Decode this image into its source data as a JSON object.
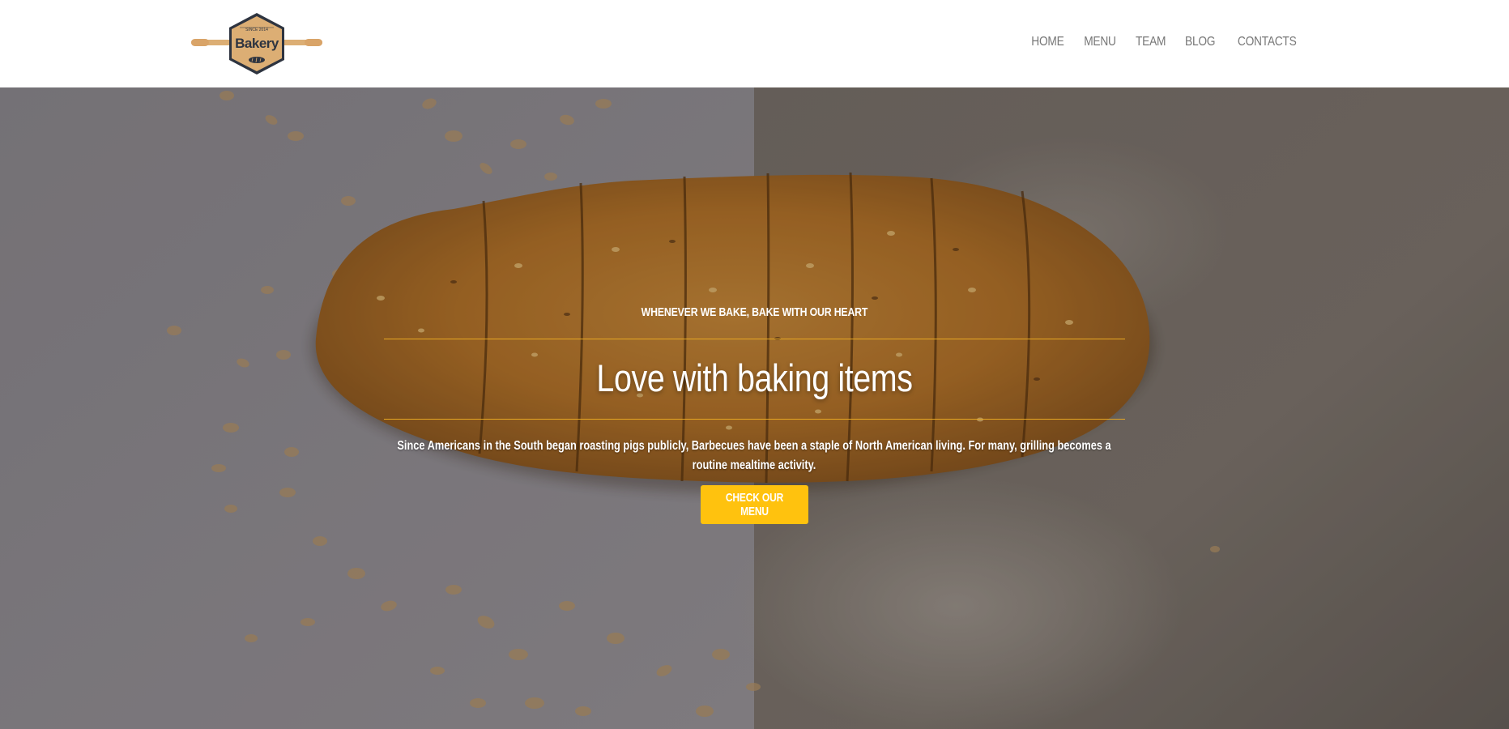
{
  "logo": {
    "text": "Bakery",
    "since": "SINCE 2014"
  },
  "nav": {
    "items": [
      "HOME",
      "MENU",
      "TEAM",
      "BLOG",
      "CONTACTS"
    ]
  },
  "hero": {
    "eyebrow": "WHENEVER WE BAKE, BAKE WITH OUR HEART",
    "headline": "Love with baking items",
    "description": "Since Americans in the South began roasting pigs publicly, Barbecues have been a staple of North American living. For many, grilling becomes a routine mealtime activity.",
    "cta_label": "CHECK OUR MENU"
  },
  "colors": {
    "accent": "#ffc20e",
    "rule": "#e8a823",
    "nav_text": "#777777",
    "logo_fill": "#dcae74",
    "logo_stroke": "#2e3440"
  }
}
